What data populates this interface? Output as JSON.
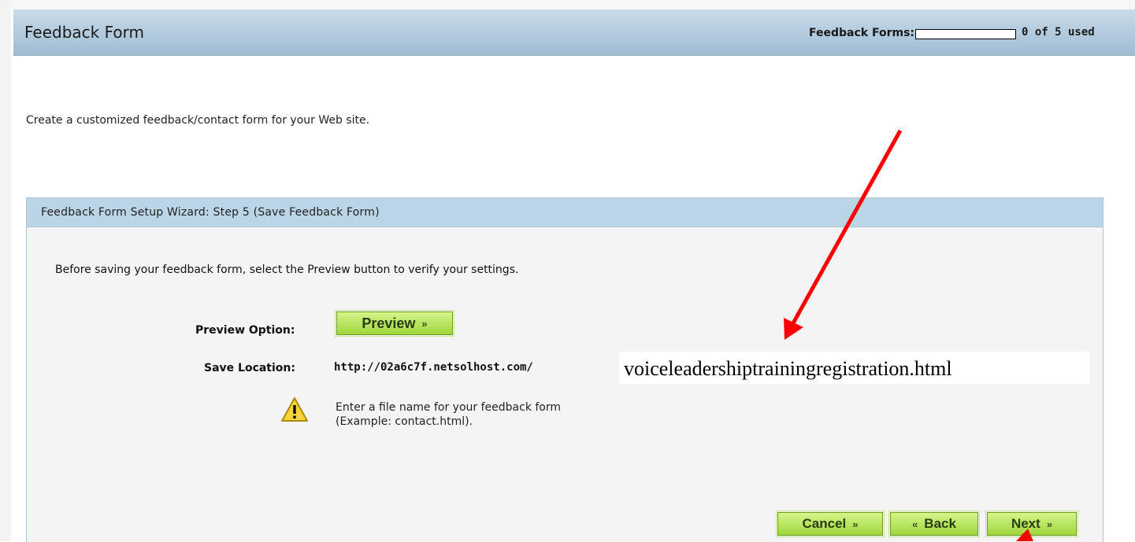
{
  "header": {
    "title": "Feedback Form",
    "quota_label": "Feedback Forms:",
    "quota_text": "0 of 5 used",
    "quota_fraction": 0
  },
  "intro": "Create a customized feedback/contact form for your Web site.",
  "wizard": {
    "heading": "Feedback Form Setup Wizard: Step 5  (Save Feedback Form)",
    "instruction": "Before saving your feedback form, select the Preview button to verify your settings.",
    "preview_label": "Preview Option:",
    "preview_button": "Preview",
    "save_label": "Save Location:",
    "save_url": "http://02a6c7f.netsolhost.com/",
    "filename_value": "voiceleadershiptrainingregistration.html",
    "warning_line1": "Enter a file name for your feedback form",
    "warning_line2": "(Example: contact.html).",
    "cancel_button": "Cancel",
    "back_button": "Back",
    "next_button": "Next"
  },
  "icons": {
    "warning": "warning-icon",
    "chevron_right": "double-chevron-right-icon",
    "chevron_left": "double-chevron-left-icon",
    "annotation_arrow": "red-arrow-annotation"
  },
  "colors": {
    "header_bg": "#b3cde0",
    "button_green": "#b7e35a",
    "annotation_red": "#ff0000"
  }
}
